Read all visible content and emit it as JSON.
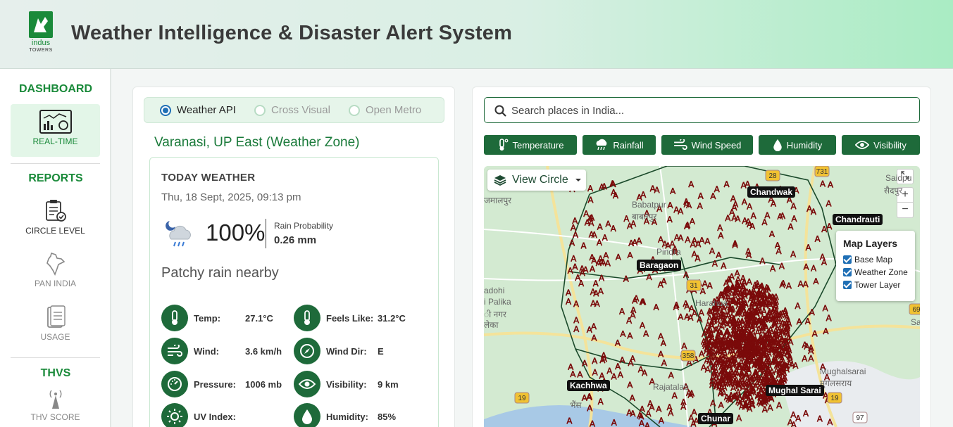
{
  "header": {
    "logo_text": "indus",
    "logo_sub": "TOWERS",
    "title": "Weather Intelligence & Disaster Alert System"
  },
  "sidebar": {
    "sections": [
      {
        "label": "DASHBOARD",
        "items": [
          {
            "label": "REAL-TIME",
            "icon": "dashboard-icon",
            "active": true
          }
        ]
      },
      {
        "label": "REPORTS",
        "items": [
          {
            "label": "CIRCLE LEVEL",
            "icon": "clipboard-report-icon"
          },
          {
            "label": "PAN INDIA",
            "icon": "india-map-icon"
          },
          {
            "label": "USAGE",
            "icon": "document-icon"
          }
        ]
      },
      {
        "label": "THVS",
        "items": [
          {
            "label": "THV SCORE",
            "icon": "tower-signal-icon"
          }
        ]
      }
    ]
  },
  "source_selector": {
    "options": [
      "Weather API",
      "Cross Visual",
      "Open Metro"
    ],
    "selected": "Weather API"
  },
  "location": "Varanasi, UP East (Weather Zone)",
  "weather": {
    "heading": "TODAY WEATHER",
    "datetime": "Thu, 18 Sept, 2025, 09:13 pm",
    "condition_icon": "night-rain-cloud-icon",
    "rain_percent": "100%",
    "rain_prob_label": "Rain Probability",
    "rain_amount": "0.26 mm",
    "condition": "Patchy rain nearby",
    "metrics": [
      {
        "label": "Temp:",
        "value": "27.1°C",
        "icon": "thermometer-icon"
      },
      {
        "label": "Feels Like:",
        "value": "31.2°C",
        "icon": "thermometer-icon"
      },
      {
        "label": "Wind:",
        "value": "3.6 km/h",
        "icon": "wind-icon"
      },
      {
        "label": "Wind Dir:",
        "value": "E",
        "icon": "compass-icon"
      },
      {
        "label": "Pressure:",
        "value": "1006 mb",
        "icon": "gauge-icon"
      },
      {
        "label": "Visibility:",
        "value": "9 km",
        "icon": "eye-icon"
      },
      {
        "label": "UV Index:",
        "value": "",
        "icon": "sun-icon"
      },
      {
        "label": "Humidity:",
        "value": "85%",
        "icon": "droplet-icon"
      }
    ]
  },
  "search": {
    "placeholder": "Search places in India..."
  },
  "layer_buttons": [
    {
      "label": "Temperature",
      "icon": "thermometer-icon"
    },
    {
      "label": "Rainfall",
      "icon": "rain-cloud-icon"
    },
    {
      "label": "Wind Speed",
      "icon": "wind-icon"
    },
    {
      "label": "Humidity",
      "icon": "droplet-icon"
    },
    {
      "label": "Visibility",
      "icon": "eye-icon"
    }
  ],
  "map": {
    "view_selector": "View Circle",
    "zoom_in": "+",
    "zoom_out": "−",
    "layers_title": "Map Layers",
    "layers": [
      "Base Map",
      "Weather Zone",
      "Tower Layer"
    ],
    "place_labels": [
      "Chandwak",
      "Chandrauti",
      "Baragaon",
      "Kachhwa",
      "Mughal Sarai",
      "Chunar"
    ],
    "map_texts": [
      "Saidpu",
      "सैदपुर",
      "जमालपुर",
      "Babatpur",
      "बाबतपुर",
      "Pindra",
      "Harahua",
      "adohi",
      "i Palika",
      "ी नगर",
      "लेका",
      "Mughalsarai",
      "मुगलसराय",
      "भैंस",
      "Rajatalab",
      "Sa"
    ],
    "road_labels": [
      "28",
      "731",
      "69",
      "19",
      "19",
      "358",
      "97",
      "31"
    ],
    "tower_color": "#7a0a0a"
  }
}
